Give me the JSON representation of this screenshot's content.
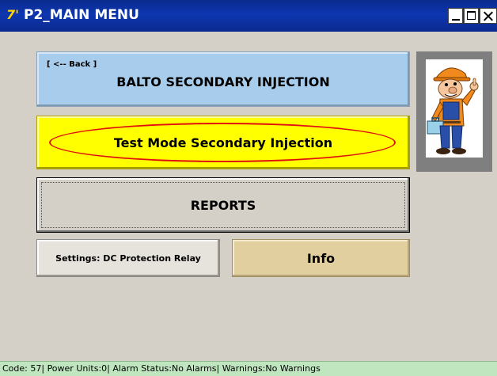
{
  "window": {
    "title": "P2_MAIN MENU"
  },
  "menu": {
    "balto_back_label": "[ <-- Back ]",
    "balto_label": "BALTO SECONDARY INJECTION",
    "test_mode_label": "Test Mode Secondary Injection",
    "reports_label": "REPORTS",
    "settings_label": "Settings: DC Protection Relay",
    "info_label": "Info"
  },
  "status_bar": {
    "text": "Code: 57| Power Units:0| Alarm Status:No Alarms| Warnings:No Warnings"
  },
  "icons": {
    "app": "app-icon",
    "mascot": "worker-mascot-icon",
    "minimize": "minimize-icon",
    "maximize": "maximize-icon",
    "close": "close-icon"
  },
  "colors": {
    "titlebar": "#0a2a8e",
    "balto_button": "#a8ccec",
    "test_button": "#ffff00",
    "highlight_oval": "#e01010",
    "info_button": "#e1cf9f",
    "status_bar": "#bfe6bf"
  }
}
